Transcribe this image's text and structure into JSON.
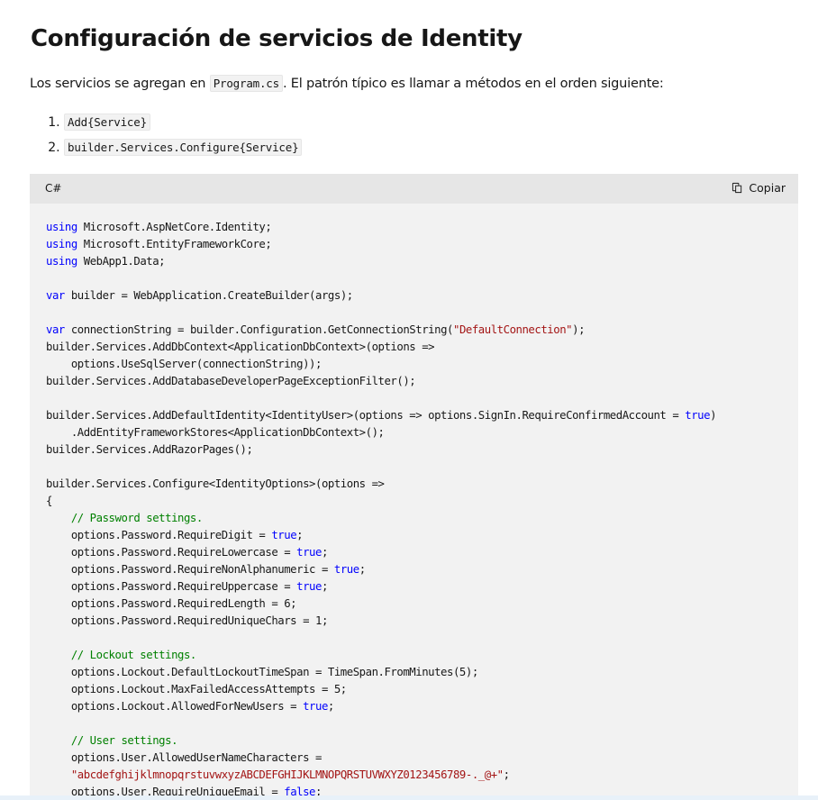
{
  "heading": "Configuración de servicios de Identity",
  "intro": {
    "before": "Los servicios se agregan en ",
    "code": "Program.cs",
    "after": ". El patrón típico es llamar a métodos en el orden siguiente:"
  },
  "steps": [
    {
      "number": "1.",
      "code": "Add{Service}"
    },
    {
      "number": "2.",
      "code": "builder.Services.Configure{Service}"
    }
  ],
  "code_block": {
    "language": "C#",
    "copy_label": "Copiar",
    "lines": [
      [
        [
          "kw",
          "using"
        ],
        [
          "t",
          " Microsoft.AspNetCore.Identity;"
        ]
      ],
      [
        [
          "kw",
          "using"
        ],
        [
          "t",
          " Microsoft.EntityFrameworkCore;"
        ]
      ],
      [
        [
          "kw",
          "using"
        ],
        [
          "t",
          " WebApp1.Data;"
        ]
      ],
      [],
      [
        [
          "kw",
          "var"
        ],
        [
          "t",
          " builder = WebApplication.CreateBuilder(args);"
        ]
      ],
      [],
      [
        [
          "kw",
          "var"
        ],
        [
          "t",
          " connectionString = builder.Configuration.GetConnectionString("
        ],
        [
          "str",
          "\"DefaultConnection\""
        ],
        [
          "t",
          ");"
        ]
      ],
      [
        [
          "t",
          "builder.Services.AddDbContext<ApplicationDbContext>(options =>"
        ]
      ],
      [
        [
          "t",
          "    options.UseSqlServer(connectionString));"
        ]
      ],
      [
        [
          "t",
          "builder.Services.AddDatabaseDeveloperPageExceptionFilter();"
        ]
      ],
      [],
      [
        [
          "t",
          "builder.Services.AddDefaultIdentity<IdentityUser>(options => options.SignIn.RequireConfirmedAccount = "
        ],
        [
          "kw",
          "true"
        ],
        [
          "t",
          ")"
        ]
      ],
      [
        [
          "t",
          "    .AddEntityFrameworkStores<ApplicationDbContext>();"
        ]
      ],
      [
        [
          "t",
          "builder.Services.AddRazorPages();"
        ]
      ],
      [],
      [
        [
          "t",
          "builder.Services.Configure<IdentityOptions>(options =>"
        ]
      ],
      [
        [
          "t",
          "{"
        ]
      ],
      [
        [
          "cm",
          "    // Password settings."
        ]
      ],
      [
        [
          "t",
          "    options.Password.RequireDigit = "
        ],
        [
          "kw",
          "true"
        ],
        [
          "t",
          ";"
        ]
      ],
      [
        [
          "t",
          "    options.Password.RequireLowercase = "
        ],
        [
          "kw",
          "true"
        ],
        [
          "t",
          ";"
        ]
      ],
      [
        [
          "t",
          "    options.Password.RequireNonAlphanumeric = "
        ],
        [
          "kw",
          "true"
        ],
        [
          "t",
          ";"
        ]
      ],
      [
        [
          "t",
          "    options.Password.RequireUppercase = "
        ],
        [
          "kw",
          "true"
        ],
        [
          "t",
          ";"
        ]
      ],
      [
        [
          "t",
          "    options.Password.RequiredLength = 6;"
        ]
      ],
      [
        [
          "t",
          "    options.Password.RequiredUniqueChars = 1;"
        ]
      ],
      [],
      [
        [
          "cm",
          "    // Lockout settings."
        ]
      ],
      [
        [
          "t",
          "    options.Lockout.DefaultLockoutTimeSpan = TimeSpan.FromMinutes(5);"
        ]
      ],
      [
        [
          "t",
          "    options.Lockout.MaxFailedAccessAttempts = 5;"
        ]
      ],
      [
        [
          "t",
          "    options.Lockout.AllowedForNewUsers = "
        ],
        [
          "kw",
          "true"
        ],
        [
          "t",
          ";"
        ]
      ],
      [],
      [
        [
          "cm",
          "    // User settings."
        ]
      ],
      [
        [
          "t",
          "    options.User.AllowedUserNameCharacters ="
        ]
      ],
      [
        [
          "t",
          "    "
        ],
        [
          "str",
          "\"abcdefghijklmnopqrstuvwxyzABCDEFGHIJKLMNOPQRSTUVWXYZ0123456789-._@+\""
        ],
        [
          "t",
          ";"
        ]
      ],
      [
        [
          "t",
          "    options.User.RequireUniqueEmail = "
        ],
        [
          "kw",
          "false"
        ],
        [
          "t",
          ";"
        ]
      ]
    ]
  },
  "colors": {
    "keyword": "#0101fd",
    "string": "#a31515",
    "comment": "#008000",
    "code_background": "#f2f2f2",
    "code_header": "#e6e6e6"
  },
  "icons": {
    "copy": "copy-icon"
  }
}
